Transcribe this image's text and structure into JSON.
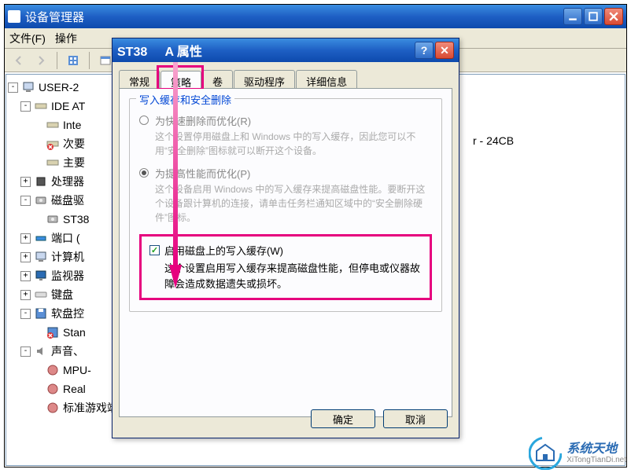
{
  "main": {
    "title": "设备管理器",
    "menus": {
      "file": "文件(F)",
      "action": "操作"
    },
    "tree": {
      "root": "USER-2",
      "ide": "IDE AT",
      "intel": "Inte",
      "secondary": "次要",
      "primary": "主要",
      "cpu": "处理器",
      "disk": "磁盘驱",
      "st": "ST38",
      "port": "端口 (",
      "computer": "计算机",
      "monitor": "监视器",
      "keyboard": "键盘",
      "floppy": "软盘控",
      "stan": "Stan",
      "sound": "声音、",
      "mpu": "MPU-",
      "real": "Real",
      "gamectrl": "标准游戏端口"
    },
    "bg_trail": "r - 24CB"
  },
  "dialog": {
    "title_prefix": "ST38",
    "title_suffix": "A 属性",
    "tabs": {
      "general": "常规",
      "policy": "策略",
      "volumes": "卷",
      "driver": "驱动程序",
      "details": "详细信息"
    },
    "group_title": "写入缓存和安全删除",
    "opt1": {
      "label": "为快速删除而优化(R)",
      "desc": "这个设置停用磁盘上和 Windows 中的写入缓存，因此您可以不用“安全删除”图标就可以断开这个设备。"
    },
    "opt2": {
      "label": "为提高性能而优化(P)",
      "desc": "这个设备启用 Windows 中的写入缓存来提高磁盘性能。要断开这个设备跟计算机的连接，请单击任务栏通知区域中的“安全删除硬件”图标。"
    },
    "chk": {
      "label": "启用磁盘上的写入缓存(W)",
      "desc": "这个设置启用写入缓存来提高磁盘性能，但停电或仪器故障会造成数据遗失或损坏。"
    },
    "buttons": {
      "ok": "确定",
      "cancel": "取消"
    }
  },
  "watermark": {
    "cn": "系统天地",
    "url": "XiTongTianDi.net"
  }
}
